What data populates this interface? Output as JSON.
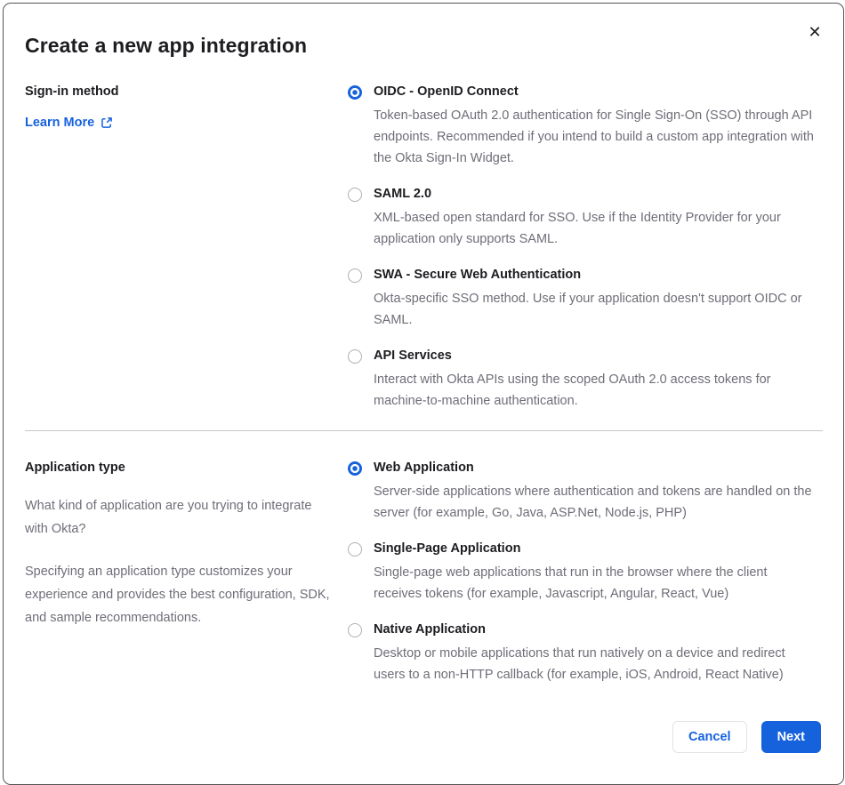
{
  "dialog": {
    "title": "Create a new app integration",
    "close_icon": "✕"
  },
  "signin_section": {
    "heading": "Sign-in method",
    "learn_more_label": "Learn More",
    "options": [
      {
        "label": "OIDC - OpenID Connect",
        "description": "Token-based OAuth 2.0 authentication for Single Sign-On (SSO) through API endpoints. Recommended if you intend to build a custom app integration with the Okta Sign-In Widget.",
        "selected": true
      },
      {
        "label": "SAML 2.0",
        "description": "XML-based open standard for SSO. Use if the Identity Provider for your application only supports SAML.",
        "selected": false
      },
      {
        "label": "SWA - Secure Web Authentication",
        "description": "Okta-specific SSO method. Use if your application doesn't support OIDC or SAML.",
        "selected": false
      },
      {
        "label": "API Services",
        "description": "Interact with Okta APIs using the scoped OAuth 2.0 access tokens for machine-to-machine authentication.",
        "selected": false
      }
    ]
  },
  "apptype_section": {
    "heading": "Application type",
    "paragraph_1": "What kind of application are you trying to integrate with Okta?",
    "paragraph_2": "Specifying an application type customizes your experience and provides the best configuration, SDK, and sample recommendations.",
    "options": [
      {
        "label": "Web Application",
        "description": "Server-side applications where authentication and tokens are handled on the server (for example, Go, Java, ASP.Net, Node.js, PHP)",
        "selected": true
      },
      {
        "label": "Single-Page Application",
        "description": "Single-page web applications that run in the browser where the client receives tokens (for example, Javascript, Angular, React, Vue)",
        "selected": false
      },
      {
        "label": "Native Application",
        "description": "Desktop or mobile applications that run natively on a device and redirect users to a non-HTTP callback (for example, iOS, Android, React Native)",
        "selected": false
      }
    ]
  },
  "footer": {
    "cancel_label": "Cancel",
    "next_label": "Next"
  },
  "colors": {
    "primary_blue": "#1662dd",
    "heading_text": "#1d1d21",
    "body_text": "#6e6e78",
    "divider": "#c6c6cb",
    "radio_unselected_border": "#aeaeb6",
    "dialog_border": "#55555a"
  }
}
